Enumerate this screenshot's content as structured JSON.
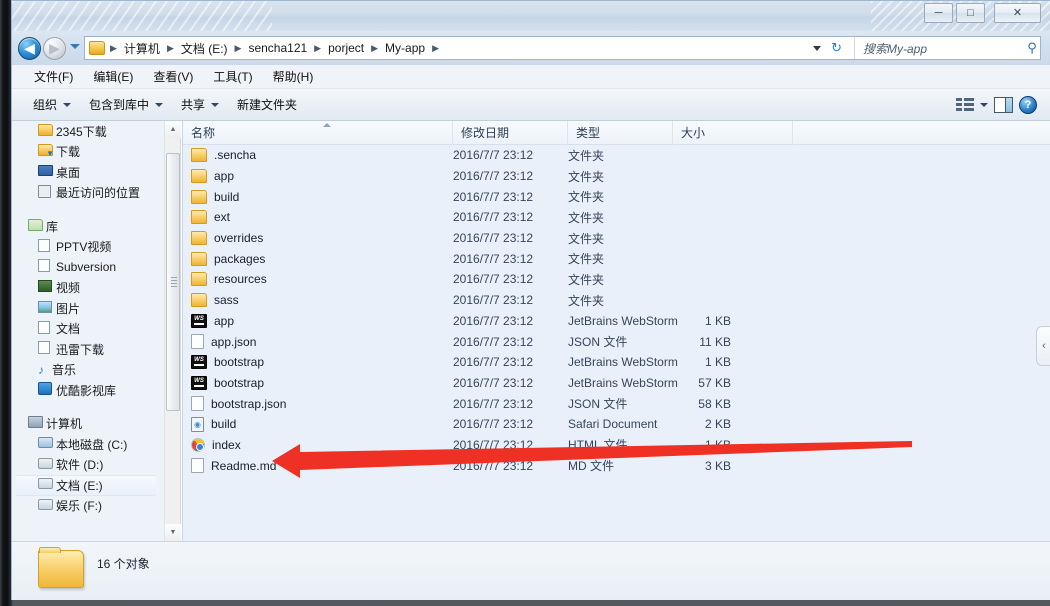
{
  "window": {
    "controls": {
      "minimize": "─",
      "maximize": "□",
      "close": "✕"
    }
  },
  "navigation": {
    "back_glyph": "◀",
    "forward_glyph": "▶",
    "history_dropdown": "",
    "refresh_glyph": "↻",
    "breadcrumb": [
      "计算机",
      "文档 (E:)",
      "sencha121",
      "porject",
      "My-app"
    ],
    "breadcrumb_separator": "▶"
  },
  "search": {
    "placeholder": "搜索My-app",
    "icon_glyph": "⚲"
  },
  "menubar": {
    "items": [
      "文件(F)",
      "编辑(E)",
      "查看(V)",
      "工具(T)",
      "帮助(H)"
    ]
  },
  "commandbar": {
    "items": [
      {
        "label": "组织",
        "has_caret": true
      },
      {
        "label": "包含到库中",
        "has_caret": true
      },
      {
        "label": "共享",
        "has_caret": true
      },
      {
        "label": "新建文件夹",
        "has_caret": false
      }
    ],
    "help_glyph": "?"
  },
  "sidebar": {
    "groups": [
      {
        "items": [
          {
            "label": "2345下载",
            "icon": "folder-yellow-icon",
            "indent": 1,
            "selected": false
          },
          {
            "label": "下载",
            "icon": "downloads-folder-icon",
            "indent": 1,
            "selected": false
          },
          {
            "label": "桌面",
            "icon": "desktop-icon",
            "indent": 1,
            "selected": false
          },
          {
            "label": "最近访问的位置",
            "icon": "recent-places-icon",
            "indent": 1,
            "selected": false
          }
        ]
      },
      {
        "items": [
          {
            "label": "库",
            "icon": "library-icon",
            "indent": 0,
            "selected": false
          },
          {
            "label": "PPTV视频",
            "icon": "document-icon",
            "indent": 1,
            "selected": false
          },
          {
            "label": "Subversion",
            "icon": "document-icon",
            "indent": 1,
            "selected": false
          },
          {
            "label": "视频",
            "icon": "video-icon",
            "indent": 1,
            "selected": false
          },
          {
            "label": "图片",
            "icon": "picture-icon",
            "indent": 1,
            "selected": false
          },
          {
            "label": "文档",
            "icon": "document-icon",
            "indent": 1,
            "selected": false
          },
          {
            "label": "迅雷下载",
            "icon": "document-icon",
            "indent": 1,
            "selected": false
          },
          {
            "label": "音乐",
            "icon": "music-icon",
            "indent": 1,
            "selected": false
          },
          {
            "label": "优酷影视库",
            "icon": "youku-icon",
            "indent": 1,
            "selected": false
          }
        ]
      },
      {
        "items": [
          {
            "label": "计算机",
            "icon": "computer-icon",
            "indent": 0,
            "selected": false
          },
          {
            "label": "本地磁盘 (C:)",
            "icon": "system-drive-icon",
            "indent": 1,
            "selected": false
          },
          {
            "label": "软件 (D:)",
            "icon": "drive-icon",
            "indent": 1,
            "selected": false
          },
          {
            "label": "文档 (E:)",
            "icon": "drive-icon",
            "indent": 1,
            "selected": true
          },
          {
            "label": "娱乐 (F:)",
            "icon": "drive-icon",
            "indent": 1,
            "selected": false
          }
        ]
      }
    ]
  },
  "filelist": {
    "columns": [
      {
        "key": "name",
        "label": "名称"
      },
      {
        "key": "date",
        "label": "修改日期"
      },
      {
        "key": "type",
        "label": "类型"
      },
      {
        "key": "size",
        "label": "大小"
      }
    ],
    "sort_column": "name",
    "sort_direction": "ascending",
    "rows": [
      {
        "name": ".sencha",
        "date": "2016/7/7 23:12",
        "type": "文件夹",
        "size": "",
        "icon": "folder-icon"
      },
      {
        "name": "app",
        "date": "2016/7/7 23:12",
        "type": "文件夹",
        "size": "",
        "icon": "folder-icon"
      },
      {
        "name": "build",
        "date": "2016/7/7 23:12",
        "type": "文件夹",
        "size": "",
        "icon": "folder-icon"
      },
      {
        "name": "ext",
        "date": "2016/7/7 23:12",
        "type": "文件夹",
        "size": "",
        "icon": "folder-icon"
      },
      {
        "name": "overrides",
        "date": "2016/7/7 23:12",
        "type": "文件夹",
        "size": "",
        "icon": "folder-icon"
      },
      {
        "name": "packages",
        "date": "2016/7/7 23:12",
        "type": "文件夹",
        "size": "",
        "icon": "folder-icon"
      },
      {
        "name": "resources",
        "date": "2016/7/7 23:12",
        "type": "文件夹",
        "size": "",
        "icon": "folder-icon"
      },
      {
        "name": "sass",
        "date": "2016/7/7 23:12",
        "type": "文件夹",
        "size": "",
        "icon": "folder-icon"
      },
      {
        "name": "app",
        "date": "2016/7/7 23:12",
        "type": "JetBrains WebStorm",
        "size": "1 KB",
        "icon": "webstorm-icon"
      },
      {
        "name": "app.json",
        "date": "2016/7/7 23:12",
        "type": "JSON 文件",
        "size": "11 KB",
        "icon": "blank-file-icon"
      },
      {
        "name": "bootstrap",
        "date": "2016/7/7 23:12",
        "type": "JetBrains WebStorm",
        "size": "1 KB",
        "icon": "webstorm-icon"
      },
      {
        "name": "bootstrap",
        "date": "2016/7/7 23:12",
        "type": "JetBrains WebStorm",
        "size": "57 KB",
        "icon": "webstorm-icon"
      },
      {
        "name": "bootstrap.json",
        "date": "2016/7/7 23:12",
        "type": "JSON 文件",
        "size": "58 KB",
        "icon": "blank-file-icon"
      },
      {
        "name": "build",
        "date": "2016/7/7 23:12",
        "type": "Safari Document",
        "size": "2 KB",
        "icon": "safari-icon"
      },
      {
        "name": "index",
        "date": "2016/7/7 23:12",
        "type": "HTML 文件",
        "size": "1 KB",
        "icon": "chrome-icon"
      },
      {
        "name": "Readme.md",
        "date": "2016/7/7 23:12",
        "type": "MD 文件",
        "size": "3 KB",
        "icon": "blank-file-icon"
      }
    ]
  },
  "details": {
    "status_text": "16 个对象"
  },
  "annotation": {
    "arrow_color": "#ee3124",
    "points_to": "index"
  },
  "collapse": {
    "chevron": "‹"
  }
}
